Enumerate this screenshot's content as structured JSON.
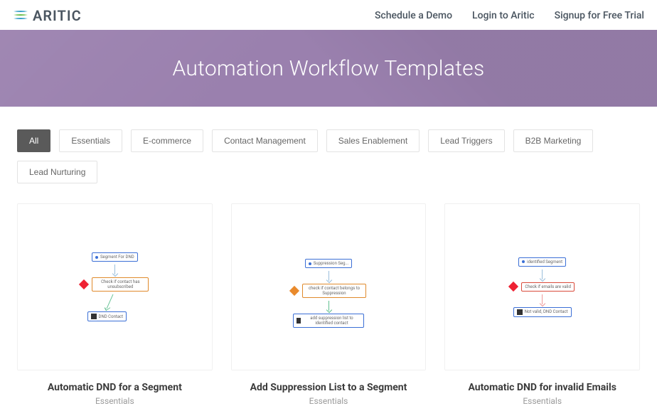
{
  "brand": {
    "name": "ARITIC"
  },
  "nav": {
    "demo": "Schedule a Demo",
    "login": "Login to Aritic",
    "signup": "Signup for Free Trial"
  },
  "hero": {
    "title": "Automation Workflow Templates"
  },
  "filters": [
    {
      "id": "all",
      "label": "All",
      "active": true
    },
    {
      "id": "essentials",
      "label": "Essentials",
      "active": false
    },
    {
      "id": "ecommerce",
      "label": "E-commerce",
      "active": false
    },
    {
      "id": "contact-management",
      "label": "Contact Management",
      "active": false
    },
    {
      "id": "sales-enablement",
      "label": "Sales Enablement",
      "active": false
    },
    {
      "id": "lead-triggers",
      "label": "Lead Triggers",
      "active": false
    },
    {
      "id": "b2b-marketing",
      "label": "B2B Marketing",
      "active": false
    },
    {
      "id": "lead-nurturing",
      "label": "Lead Nurturing",
      "active": false
    }
  ],
  "cards": [
    {
      "title": "Automatic DND for a Segment",
      "category": "Essentials",
      "wf": {
        "step1": "Segment For DND",
        "step2": "Check if contact has unsubscribed",
        "step3": "DND Contact"
      }
    },
    {
      "title": "Add Suppression List to a Segment",
      "category": "Essentials",
      "wf": {
        "step1": "Suppression Seg...",
        "step2": "check if contact belongs to Suppression",
        "step3": "add suppression list to identified contact"
      }
    },
    {
      "title": "Automatic DND for invalid Emails",
      "category": "Essentials",
      "wf": {
        "step1": "identified Segment",
        "step2": "Check if emails are valid",
        "step3": "Not valid, DND Contact"
      }
    }
  ]
}
